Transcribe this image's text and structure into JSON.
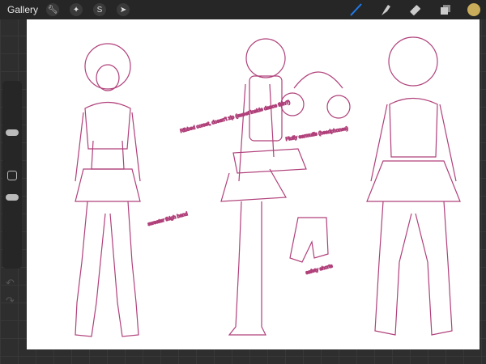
{
  "topbar": {
    "gallery_label": "Gallery",
    "tools_left": [
      "wrench-icon",
      "magic-wand-icon",
      "selection-icon",
      "transform-arrow-icon"
    ],
    "tools_right": [
      "brush-icon",
      "smudge-icon",
      "eraser-icon",
      "layers-icon"
    ],
    "active_tool": "brush",
    "current_color": "#c9ad5a",
    "brush_color": "#1e7cf0"
  },
  "artwork": {
    "stroke_color": "#b0407a",
    "notes": [
      "Ribbed corset, doesn't zip (sweet inside dance thin?)",
      "Fluffy earmuffs (headphones)",
      "safety shorts",
      "sweater thigh band"
    ]
  },
  "sidebar": {
    "undo_icon": "undo-icon",
    "redo_icon": "redo-icon"
  }
}
